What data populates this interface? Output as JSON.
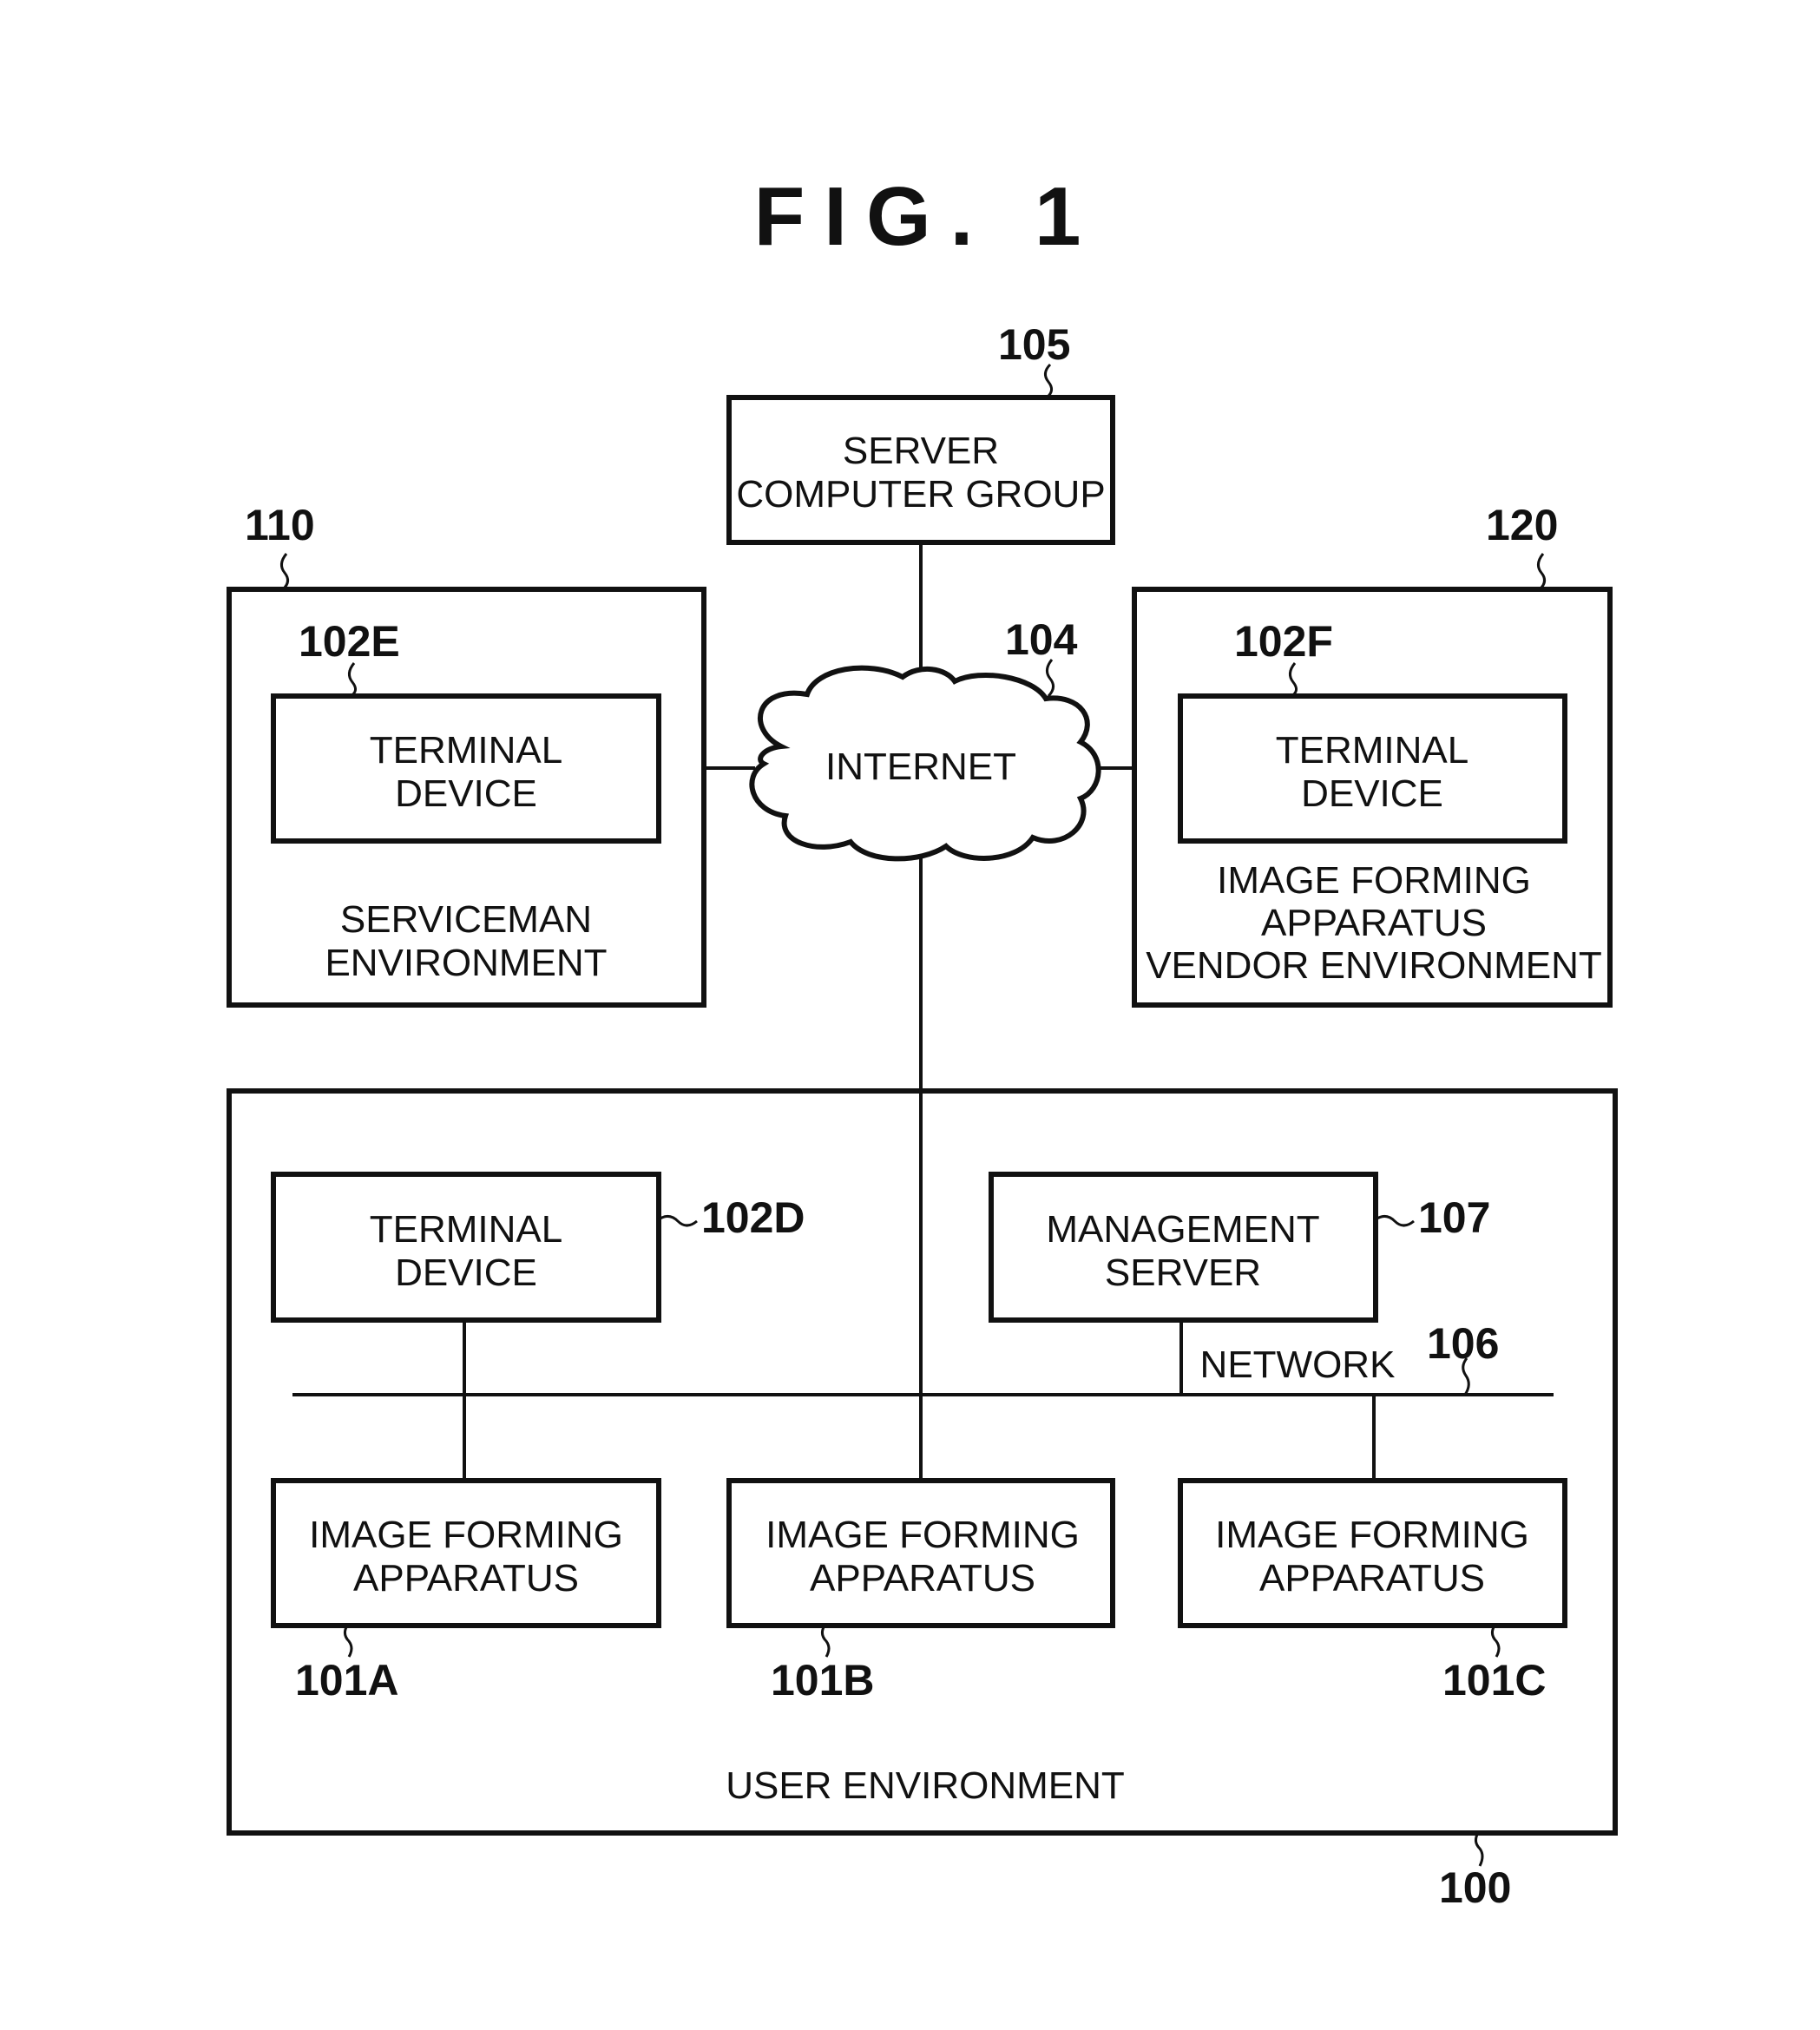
{
  "figure": {
    "title": "FIG. 1"
  },
  "server_group": {
    "ref": "105",
    "lines": [
      "SERVER",
      "COMPUTER GROUP"
    ]
  },
  "internet": {
    "ref": "104",
    "label": "INTERNET"
  },
  "serviceman_env": {
    "ref": "110",
    "lines": [
      "SERVICEMAN",
      "ENVIRONMENT"
    ],
    "terminal": {
      "ref": "102E",
      "lines": [
        "TERMINAL",
        "DEVICE"
      ]
    }
  },
  "vendor_env": {
    "ref": "120",
    "lines": [
      "IMAGE FORMING",
      "APPARATUS",
      "VENDOR ENVIRONMENT"
    ],
    "terminal": {
      "ref": "102F",
      "lines": [
        "TERMINAL",
        "DEVICE"
      ]
    }
  },
  "user_env": {
    "ref": "100",
    "label": "USER ENVIRONMENT",
    "terminal": {
      "ref": "102D",
      "lines": [
        "TERMINAL",
        "DEVICE"
      ]
    },
    "management_server": {
      "ref": "107",
      "lines": [
        "MANAGEMENT",
        "SERVER"
      ]
    },
    "network": {
      "ref": "106",
      "label": "NETWORK"
    },
    "apparatuses": [
      {
        "ref": "101A",
        "lines": [
          "IMAGE FORMING",
          "APPARATUS"
        ]
      },
      {
        "ref": "101B",
        "lines": [
          "IMAGE FORMING",
          "APPARATUS"
        ]
      },
      {
        "ref": "101C",
        "lines": [
          "IMAGE FORMING",
          "APPARATUS"
        ]
      }
    ]
  }
}
